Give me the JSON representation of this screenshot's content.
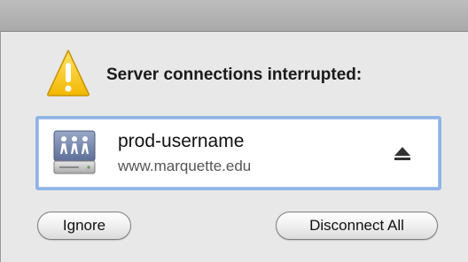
{
  "dialog": {
    "heading": "Server connections interrupted:",
    "server": {
      "name": "prod-username",
      "host": "www.marquette.edu",
      "icon": "network-server-icon",
      "eject_icon": "eject-icon"
    },
    "buttons": {
      "ignore_label": "Ignore",
      "disconnect_all_label": "Disconnect All"
    },
    "warning_icon": "warning-icon"
  },
  "colors": {
    "accent_focus": "#8fb4e6",
    "warning_yellow": "#f7c619"
  }
}
